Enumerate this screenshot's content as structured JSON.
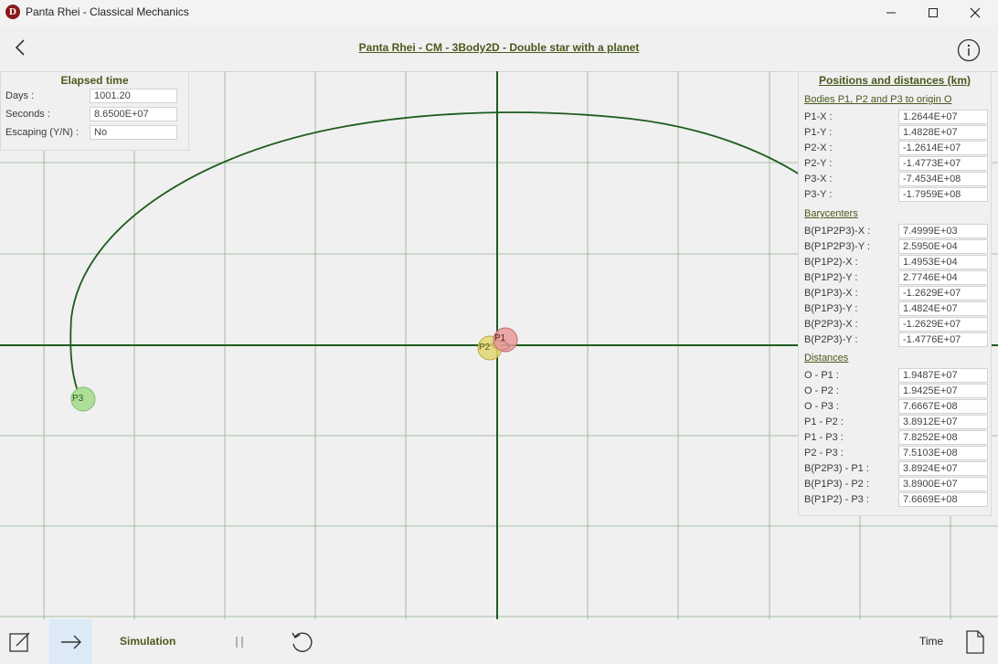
{
  "window": {
    "title": "Panta Rhei - Classical Mechanics",
    "icon_letter": "D"
  },
  "header": {
    "title": "Panta Rhei - CM - 3Body2D - Double star with a planet"
  },
  "elapsed": {
    "title": "Elapsed time",
    "rows": [
      {
        "label": "Days :",
        "value": "1001.20"
      },
      {
        "label": "Seconds :",
        "value": "8.6500E+07"
      },
      {
        "label": "Escaping (Y/N) :",
        "value": "No"
      }
    ]
  },
  "positions": {
    "title": "Positions and distances (km)",
    "section_bodies": "Bodies P1, P2 and P3 to origin O",
    "bodies": [
      {
        "label": "P1-X :",
        "value": "1.2644E+07"
      },
      {
        "label": "P1-Y :",
        "value": "1.4828E+07"
      },
      {
        "label": "P2-X :",
        "value": "-1.2614E+07"
      },
      {
        "label": "P2-Y :",
        "value": "-1.4773E+07"
      },
      {
        "label": "P3-X :",
        "value": "-7.4534E+08"
      },
      {
        "label": "P3-Y :",
        "value": "-1.7959E+08"
      }
    ],
    "section_bary": "Barycenters",
    "bary": [
      {
        "label": "B(P1P2P3)-X :",
        "value": "7.4999E+03"
      },
      {
        "label": "B(P1P2P3)-Y :",
        "value": "2.5950E+04"
      },
      {
        "label": "B(P1P2)-X :",
        "value": "1.4953E+04"
      },
      {
        "label": "B(P1P2)-Y :",
        "value": "2.7746E+04"
      },
      {
        "label": "B(P1P3)-X :",
        "value": "-1.2629E+07"
      },
      {
        "label": "B(P1P3)-Y :",
        "value": "1.4824E+07"
      },
      {
        "label": "B(P2P3)-X :",
        "value": "-1.2629E+07"
      },
      {
        "label": "B(P2P3)-Y :",
        "value": "-1.4776E+07"
      }
    ],
    "section_dist": "Distances",
    "dist": [
      {
        "label": "O - P1 :",
        "value": "1.9487E+07"
      },
      {
        "label": "O - P2 :",
        "value": "1.9425E+07"
      },
      {
        "label": "O - P3 :",
        "value": "7.6667E+08"
      },
      {
        "label": "P1 - P2 :",
        "value": "3.8912E+07"
      },
      {
        "label": "P1 - P3 :",
        "value": "7.8252E+08"
      },
      {
        "label": "P2 - P3 :",
        "value": "7.5103E+08"
      },
      {
        "label": "B(P2P3) - P1 :",
        "value": "3.8924E+07"
      },
      {
        "label": "B(P1P3) - P2 :",
        "value": "3.8900E+07"
      },
      {
        "label": "B(P1P2) - P3 :",
        "value": "7.6669E+08"
      }
    ]
  },
  "canvas": {
    "bodies": [
      {
        "name": "P1",
        "color": "#e89a9a"
      },
      {
        "name": "P2",
        "color": "#e3d673"
      },
      {
        "name": "P3",
        "color": "#a6dc8e"
      }
    ],
    "orbit_color": "#1e5c1e",
    "axis_color": "#1e5c1e",
    "grid_color": "#8fb08f"
  },
  "toolbar": {
    "simulation_label": "Simulation",
    "time_label": "Time"
  },
  "colors": {
    "accent": "#4a5a1e",
    "play_active_bg": "#dceaf7"
  }
}
